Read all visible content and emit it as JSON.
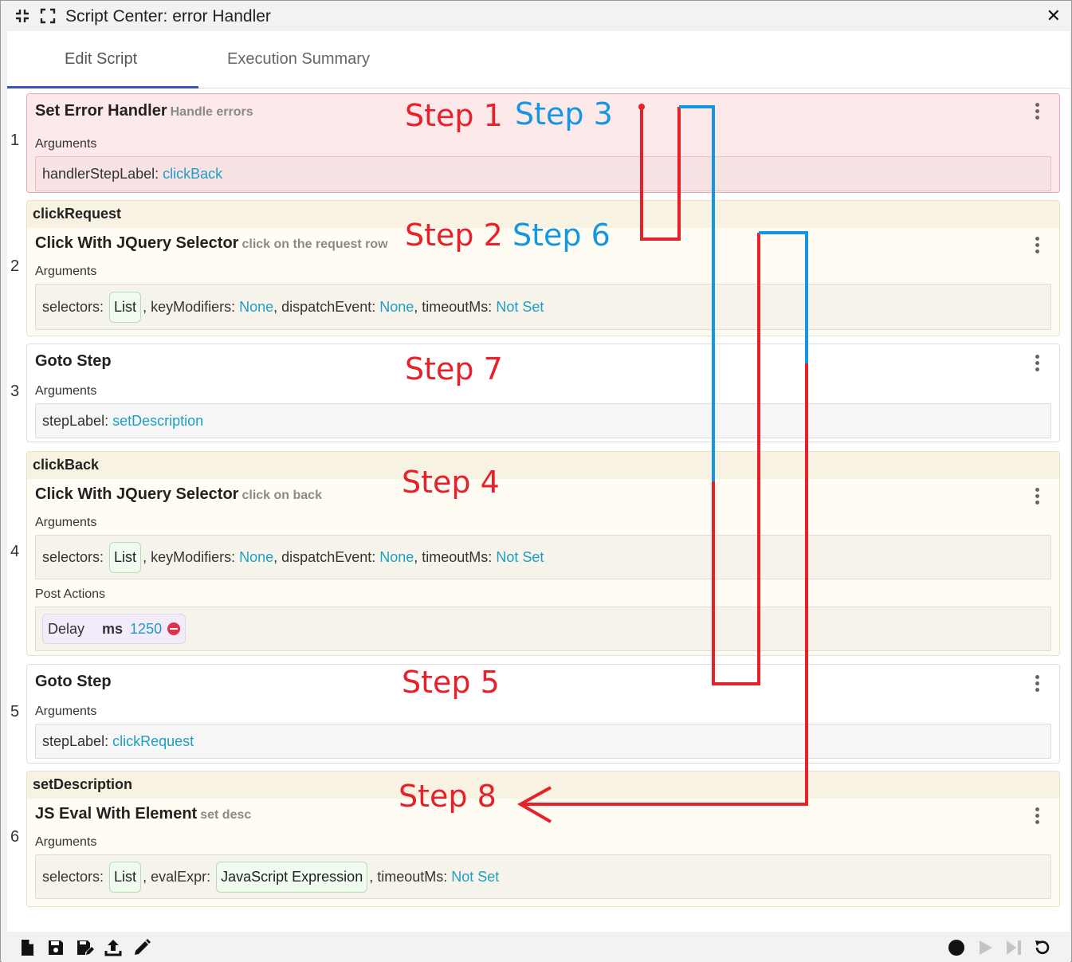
{
  "window": {
    "title": "Script Center: error Handler",
    "close_label": "✕"
  },
  "tabs": [
    {
      "label": "Edit Script"
    },
    {
      "label": "Execution Summary"
    }
  ],
  "steps": [
    {
      "number": "1",
      "command": "Set Error Handler",
      "description": "Handle errors",
      "args_label": "Arguments",
      "args": {
        "k1": "handlerStepLabel:",
        "v1": "clickBack"
      }
    },
    {
      "number": "2",
      "step_label": "clickRequest",
      "command": "Click With JQuery Selector",
      "description": "click on the request row",
      "args_label": "Arguments",
      "args": {
        "k1": "selectors:",
        "chip1": "List",
        "k2": ", keyModifiers:",
        "v2": "None",
        "k3": ", dispatchEvent:",
        "v3": "None",
        "k4": ", timeoutMs:",
        "v4": "Not Set"
      }
    },
    {
      "number": "3",
      "command": "Goto Step",
      "args_label": "Arguments",
      "args": {
        "k1": "stepLabel:",
        "v1": "setDescription"
      }
    },
    {
      "number": "4",
      "step_label": "clickBack",
      "command": "Click With JQuery Selector",
      "description": "click on back",
      "args_label": "Arguments",
      "args": {
        "k1": "selectors:",
        "chip1": "List",
        "k2": ", keyModifiers:",
        "v2": "None",
        "k3": ", dispatchEvent:",
        "v3": "None",
        "k4": ", timeoutMs:",
        "v4": "Not Set"
      },
      "post_label": "Post Actions",
      "post": {
        "name": "Delay",
        "key": "ms",
        "value": "1250"
      }
    },
    {
      "number": "5",
      "command": "Goto Step",
      "args_label": "Arguments",
      "args": {
        "k1": "stepLabel:",
        "v1": "clickRequest"
      }
    },
    {
      "number": "6",
      "step_label": "setDescription",
      "command": "JS Eval With Element",
      "description": "set desc",
      "args_label": "Arguments",
      "args": {
        "k1": "selectors:",
        "chip1": "List",
        "k2": ", evalExpr:",
        "chip2": "JavaScript Expression",
        "k3": ", timeoutMs:",
        "v3": "Not Set"
      }
    }
  ],
  "annotations": {
    "step1": "Step 1",
    "step2": "Step 2",
    "step3": "Step 3",
    "step4": "Step 4",
    "step5": "Step 5",
    "step6": "Step 6",
    "step7": "Step 7",
    "step8": "Step 8"
  },
  "colors": {
    "accent": "#3f51b5",
    "value": "#1e9ec4",
    "annotation_red": "#e8202a",
    "annotation_blue": "#1596e2",
    "error_card": "#fde8ea",
    "label_card": "#fffdf3"
  },
  "toolbar": {
    "left": [
      "new-file-icon",
      "save-icon",
      "save-as-icon",
      "upload-icon",
      "edit-icon"
    ],
    "right": [
      "record-icon",
      "play-icon",
      "step-forward-icon",
      "reset-icon"
    ]
  }
}
